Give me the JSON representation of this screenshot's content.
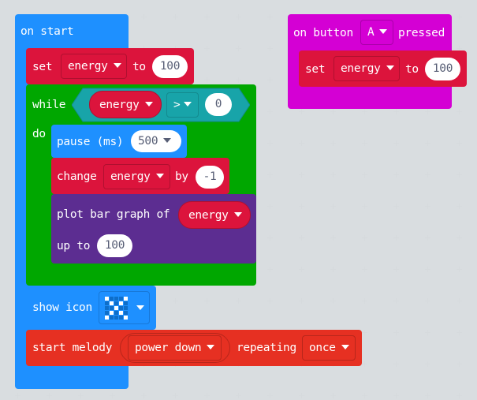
{
  "workspace": {
    "background": "#ecf0f1",
    "colors": {
      "basic": "#1e90ff",
      "variables": "#dc143c",
      "loops": "#00a700",
      "led": "#5c2d91",
      "input": "#d400d4",
      "music": "#e63022",
      "logic": "#18a4a9"
    }
  },
  "on_start": {
    "label": "on start",
    "set_block": {
      "keyword": "set",
      "variable": "energy",
      "to": "to",
      "value": "100"
    },
    "while_block": {
      "keyword": "while",
      "do": "do",
      "condition": {
        "left": "energy",
        "operator": ">",
        "right": "0"
      },
      "body": {
        "pause": {
          "label": "pause (ms)",
          "value": "500"
        },
        "change": {
          "keyword": "change",
          "variable": "energy",
          "by": "by",
          "value": "-1"
        },
        "plot": {
          "label": "plot bar graph of",
          "variable": "energy",
          "up_to": "up to",
          "value": "100"
        }
      }
    },
    "show_icon": {
      "label": "show icon",
      "icon_name": "x-icon",
      "pattern": [
        [
          1,
          0,
          0,
          0,
          1
        ],
        [
          0,
          1,
          0,
          1,
          0
        ],
        [
          0,
          0,
          1,
          0,
          0
        ],
        [
          0,
          1,
          0,
          1,
          0
        ],
        [
          1,
          0,
          0,
          0,
          1
        ]
      ]
    },
    "melody": {
      "label": "start melody",
      "melody": "power down",
      "repeating": "repeating",
      "mode": "once"
    }
  },
  "on_button": {
    "prefix": "on button",
    "button": "A",
    "suffix": "pressed",
    "set_block": {
      "keyword": "set",
      "variable": "energy",
      "to": "to",
      "value": "100"
    }
  }
}
